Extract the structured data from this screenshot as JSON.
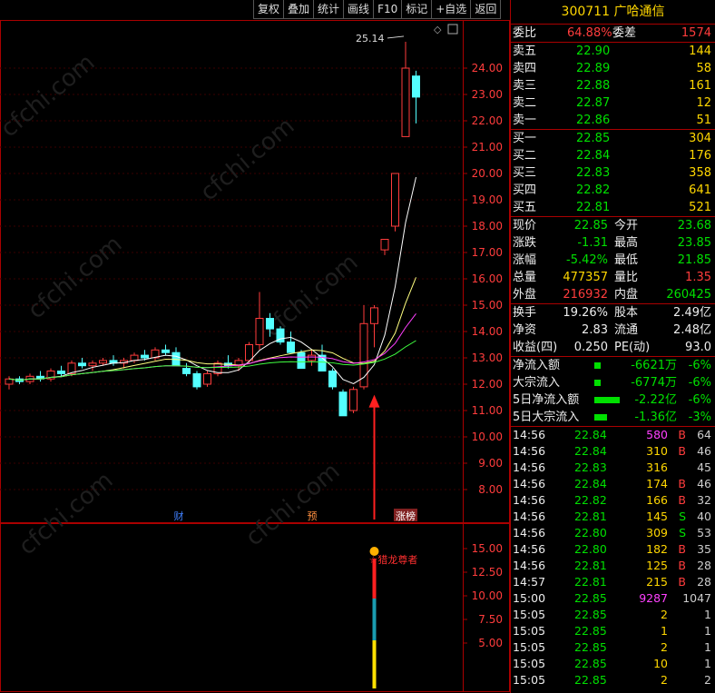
{
  "toolbar": [
    "复权",
    "叠加",
    "统计",
    "画线",
    "F10",
    "标记",
    "+自选",
    "返回"
  ],
  "stock_header": {
    "code": "300711",
    "name": "广哈通信"
  },
  "order_ratio": {
    "label_ratio": "委比",
    "ratio": "64.88%",
    "label_diff": "委差",
    "diff": "1574"
  },
  "asks": [
    {
      "label": "卖五",
      "price": "22.90",
      "vol": "144"
    },
    {
      "label": "卖四",
      "price": "22.89",
      "vol": "58"
    },
    {
      "label": "卖三",
      "price": "22.88",
      "vol": "161"
    },
    {
      "label": "卖二",
      "price": "22.87",
      "vol": "12"
    },
    {
      "label": "卖一",
      "price": "22.86",
      "vol": "51"
    }
  ],
  "bids": [
    {
      "label": "买一",
      "price": "22.85",
      "vol": "304"
    },
    {
      "label": "买二",
      "price": "22.84",
      "vol": "176"
    },
    {
      "label": "买三",
      "price": "22.83",
      "vol": "358"
    },
    {
      "label": "买四",
      "price": "22.82",
      "vol": "641"
    },
    {
      "label": "买五",
      "price": "22.81",
      "vol": "521"
    }
  ],
  "stats1": [
    {
      "l1": "现价",
      "v1": "22.85",
      "c1": "green",
      "l2": "今开",
      "v2": "23.68",
      "c2": "green"
    },
    {
      "l1": "涨跌",
      "v1": "-1.31",
      "c1": "green",
      "l2": "最高",
      "v2": "23.85",
      "c2": "green"
    },
    {
      "l1": "涨幅",
      "v1": "-5.42%",
      "c1": "green",
      "l2": "最低",
      "v2": "21.85",
      "c2": "green"
    },
    {
      "l1": "总量",
      "v1": "477357",
      "c1": "yellow",
      "l2": "量比",
      "v2": "1.35",
      "c2": "red"
    },
    {
      "l1": "外盘",
      "v1": "216932",
      "c1": "red",
      "l2": "内盘",
      "v2": "260425",
      "c2": "green"
    }
  ],
  "stats2": [
    {
      "l1": "换手",
      "v1": "19.26%",
      "l2": "股本",
      "v2": "2.49亿"
    },
    {
      "l1": "净资",
      "v1": "2.83",
      "l2": "流通",
      "v2": "2.48亿"
    },
    {
      "l1": "收益(四)",
      "v1": "0.250",
      "l2": "PE(动)",
      "v2": "93.0"
    }
  ],
  "flows": [
    {
      "label": "净流入额",
      "bar": 1,
      "val": "-6621万",
      "pct": "-6%"
    },
    {
      "label": "大宗流入",
      "bar": 1,
      "val": "-6774万",
      "pct": "-6%"
    },
    {
      "label": "5日净流入额",
      "bar": 4,
      "val": "-2.22亿",
      "pct": "-6%"
    },
    {
      "label": "5日大宗流入",
      "bar": 2,
      "val": "-1.36亿",
      "pct": "-3%"
    }
  ],
  "ticks": [
    {
      "time": "14:56",
      "price": "22.84",
      "vol": "580",
      "vc": "magenta",
      "bs": "B",
      "n": "64"
    },
    {
      "time": "14:56",
      "price": "22.84",
      "vol": "310",
      "vc": "yellow",
      "bs": "B",
      "n": "46"
    },
    {
      "time": "14:56",
      "price": "22.83",
      "vol": "316",
      "vc": "yellow",
      "bs": "",
      "n": "45"
    },
    {
      "time": "14:56",
      "price": "22.84",
      "vol": "174",
      "vc": "yellow",
      "bs": "B",
      "n": "46"
    },
    {
      "time": "14:56",
      "price": "22.82",
      "vol": "166",
      "vc": "yellow",
      "bs": "B",
      "n": "32"
    },
    {
      "time": "14:56",
      "price": "22.81",
      "vol": "145",
      "vc": "yellow",
      "bs": "S",
      "n": "40"
    },
    {
      "time": "14:56",
      "price": "22.80",
      "vol": "309",
      "vc": "yellow",
      "bs": "S",
      "n": "53"
    },
    {
      "time": "14:56",
      "price": "22.80",
      "vol": "182",
      "vc": "yellow",
      "bs": "B",
      "n": "35"
    },
    {
      "time": "14:56",
      "price": "22.81",
      "vol": "125",
      "vc": "yellow",
      "bs": "B",
      "n": "28"
    },
    {
      "time": "14:57",
      "price": "22.81",
      "vol": "215",
      "vc": "yellow",
      "bs": "B",
      "n": "28"
    },
    {
      "time": "15:00",
      "price": "22.85",
      "vol": "9287",
      "vc": "magenta",
      "bs": "",
      "n": "1047"
    },
    {
      "time": "15:05",
      "price": "22.85",
      "vol": "2",
      "vc": "yellow",
      "bs": "",
      "n": "1"
    },
    {
      "time": "15:05",
      "price": "22.85",
      "vol": "1",
      "vc": "yellow",
      "bs": "",
      "n": "1"
    },
    {
      "time": "15:05",
      "price": "22.85",
      "vol": "2",
      "vc": "yellow",
      "bs": "",
      "n": "1"
    },
    {
      "time": "15:05",
      "price": "22.85",
      "vol": "10",
      "vc": "yellow",
      "bs": "",
      "n": "1"
    },
    {
      "time": "15:05",
      "price": "22.85",
      "vol": "2",
      "vc": "yellow",
      "bs": "",
      "n": "2"
    }
  ],
  "chart_data": {
    "type": "candlestick",
    "price_axis": [
      "24.00",
      "23.00",
      "22.00",
      "21.00",
      "20.00",
      "19.00",
      "18.00",
      "17.00",
      "16.00",
      "15.00",
      "14.00",
      "13.00",
      "12.00",
      "11.00",
      "10.00",
      "9.00",
      "8.00"
    ],
    "high_label": "25.14",
    "events": [
      "财",
      "预",
      "涨榜"
    ],
    "indicator_axis": [
      "15.00",
      "12.50",
      "10.00",
      "7.50",
      "5.00"
    ],
    "indicator_label": "☆猎龙尊者",
    "candles": [
      [
        12.0,
        12.3,
        11.8,
        12.2
      ],
      [
        12.2,
        12.3,
        12.0,
        12.1
      ],
      [
        12.1,
        12.4,
        12.0,
        12.3
      ],
      [
        12.3,
        12.5,
        12.1,
        12.2
      ],
      [
        12.2,
        12.6,
        12.1,
        12.5
      ],
      [
        12.5,
        12.7,
        12.3,
        12.4
      ],
      [
        12.4,
        12.9,
        12.3,
        12.8
      ],
      [
        12.8,
        13.0,
        12.6,
        12.7
      ],
      [
        12.7,
        12.9,
        12.5,
        12.8
      ],
      [
        12.8,
        13.0,
        12.7,
        12.9
      ],
      [
        12.9,
        13.1,
        12.7,
        12.8
      ],
      [
        12.8,
        13.0,
        12.6,
        12.9
      ],
      [
        12.9,
        13.2,
        12.8,
        13.1
      ],
      [
        13.1,
        13.3,
        12.9,
        13.0
      ],
      [
        13.0,
        13.4,
        12.9,
        13.3
      ],
      [
        13.3,
        13.5,
        13.1,
        13.2
      ],
      [
        13.2,
        13.4,
        13.0,
        12.7
      ],
      [
        12.6,
        12.8,
        12.3,
        12.4
      ],
      [
        12.4,
        12.5,
        11.8,
        11.9
      ],
      [
        12.0,
        12.5,
        11.9,
        12.4
      ],
      [
        12.4,
        12.9,
        12.3,
        12.8
      ],
      [
        12.8,
        13.1,
        12.6,
        12.7
      ],
      [
        12.7,
        13.0,
        12.5,
        12.9
      ],
      [
        12.9,
        13.6,
        12.8,
        13.5
      ],
      [
        13.5,
        15.5,
        13.3,
        14.5
      ],
      [
        14.5,
        14.7,
        13.8,
        14.1
      ],
      [
        14.1,
        14.2,
        13.5,
        13.6
      ],
      [
        13.6,
        14.0,
        13.3,
        13.2
      ],
      [
        13.2,
        13.3,
        12.6,
        12.6
      ],
      [
        12.9,
        13.3,
        12.7,
        13.1
      ],
      [
        13.1,
        13.5,
        12.8,
        12.5
      ],
      [
        12.5,
        12.6,
        11.8,
        11.9
      ],
      [
        11.7,
        11.8,
        10.8,
        10.8
      ],
      [
        11.0,
        11.9,
        10.9,
        11.8
      ],
      [
        11.9,
        15.0,
        11.8,
        14.3
      ],
      [
        14.3,
        15.0,
        13.4,
        14.9
      ],
      [
        17.1,
        17.5,
        16.9,
        17.5
      ],
      [
        18.0,
        20.0,
        17.8,
        20.0
      ],
      [
        21.4,
        25.0,
        21.4,
        24.0
      ],
      [
        23.7,
        23.9,
        21.9,
        22.9
      ]
    ]
  }
}
